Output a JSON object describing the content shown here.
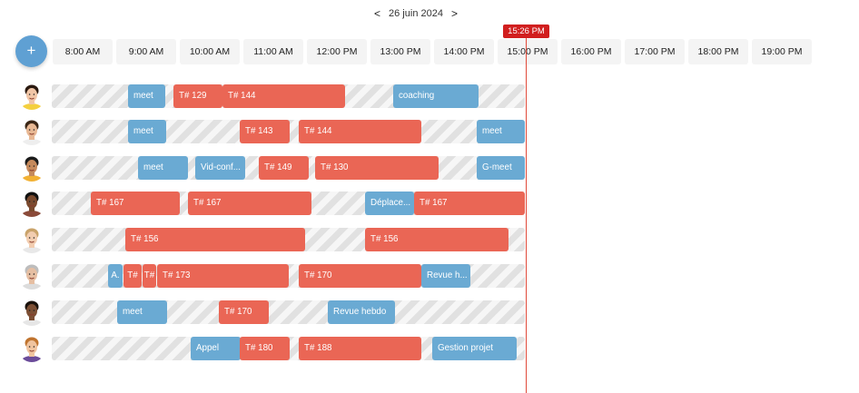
{
  "header": {
    "date": "26 juin 2024",
    "prev": "<",
    "next": ">"
  },
  "add_button": {
    "label": "+"
  },
  "hours": [
    "8:00 AM",
    "9:00 AM",
    "10:00 AM",
    "11:00 AM",
    "12:00 PM",
    "13:00 PM",
    "14:00 PM",
    "15:00 PM",
    "16:00 PM",
    "17:00 PM",
    "18:00 PM",
    "19:00 PM"
  ],
  "now": {
    "label": "15:26 PM"
  },
  "rows": [
    {
      "avatar": "person-1-avatar",
      "events": [
        {
          "label": "meet",
          "type": "blue"
        },
        {
          "label": "T# 129",
          "type": "red"
        },
        {
          "label": "T# 144",
          "type": "red"
        },
        {
          "label": "coaching",
          "type": "blue"
        }
      ]
    },
    {
      "avatar": "person-2-avatar",
      "events": [
        {
          "label": "meet",
          "type": "blue"
        },
        {
          "label": "T# 143",
          "type": "red"
        },
        {
          "label": "T# 144",
          "type": "red"
        },
        {
          "label": "meet",
          "type": "blue"
        }
      ]
    },
    {
      "avatar": "person-3-avatar",
      "events": [
        {
          "label": "meet",
          "type": "blue"
        },
        {
          "label": "Vid-conf...",
          "type": "blue"
        },
        {
          "label": "T# 149",
          "type": "red"
        },
        {
          "label": "T# 130",
          "type": "red"
        },
        {
          "label": "G-meet",
          "type": "blue"
        }
      ]
    },
    {
      "avatar": "person-4-avatar",
      "events": [
        {
          "label": "T# 167",
          "type": "red"
        },
        {
          "label": "T# 167",
          "type": "red"
        },
        {
          "label": "Déplace...",
          "type": "blue"
        },
        {
          "label": "T# 167",
          "type": "red"
        }
      ]
    },
    {
      "avatar": "person-5-avatar",
      "events": [
        {
          "label": "T# 156",
          "type": "red"
        },
        {
          "label": "T# 156",
          "type": "red"
        }
      ]
    },
    {
      "avatar": "person-6-avatar",
      "events": [
        {
          "label": "A.",
          "type": "blue"
        },
        {
          "label": "T#",
          "type": "red"
        },
        {
          "label": "T#",
          "type": "red"
        },
        {
          "label": "T# 173",
          "type": "red"
        },
        {
          "label": "T# 170",
          "type": "red"
        },
        {
          "label": "Revue h...",
          "type": "blue"
        }
      ]
    },
    {
      "avatar": "person-7-avatar",
      "events": [
        {
          "label": "meet",
          "type": "blue"
        },
        {
          "label": "T# 170",
          "type": "red"
        },
        {
          "label": "Revue hebdo",
          "type": "blue"
        }
      ]
    },
    {
      "avatar": "person-8-avatar",
      "events": [
        {
          "label": "Appel",
          "type": "blue"
        },
        {
          "label": "T# 180",
          "type": "red"
        },
        {
          "label": "T# 188",
          "type": "red"
        },
        {
          "label": "Gestion projet",
          "type": "blue"
        }
      ]
    }
  ],
  "colors": {
    "blue": "#6aaad3",
    "red": "#ea6655",
    "accent": "#5fa0d3",
    "now": "#d11f1f"
  }
}
